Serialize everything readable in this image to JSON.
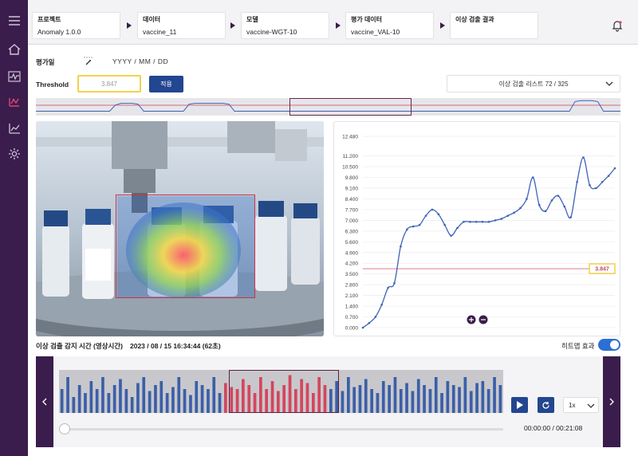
{
  "header": {
    "crumbs": [
      {
        "label": "프로젝트",
        "value": "Anomaly 1.0.0"
      },
      {
        "label": "데이터",
        "value": "vaccine_11"
      },
      {
        "label": "모델",
        "value": "vaccine-WGT-10"
      },
      {
        "label": "평가 데이터",
        "value": "vaccine_VAL-10"
      },
      {
        "label": "이상 검출 결과",
        "value": ""
      }
    ],
    "icons": [
      "menu-icon",
      "bell-icon"
    ]
  },
  "sidebar": {
    "items": [
      {
        "name": "home",
        "icon": "home-icon",
        "active": false
      },
      {
        "name": "monitor",
        "icon": "waveform-icon",
        "active": false
      },
      {
        "name": "anomaly",
        "icon": "anomaly-icon",
        "active": true
      },
      {
        "name": "chart",
        "icon": "chart-icon",
        "active": false
      },
      {
        "name": "settings",
        "icon": "gear-icon",
        "active": false
      }
    ]
  },
  "controls": {
    "date_label": "평가일",
    "date_placeholder": "YYYY / MM / DD",
    "threshold_label": "Threshold",
    "threshold_value": "3.847",
    "apply_label": "적용",
    "anomaly_list": "이상 검출 리스트 72 / 325"
  },
  "detection": {
    "label": "이상 검출 감지 시간 (영상시간)",
    "value": "2023 / 08 / 15 16:34:44 (62초)",
    "heatmap_label": "히트맵 효과",
    "heatmap_on": true
  },
  "player": {
    "speed": "1x",
    "time": "00:00:00 / 00:21:08"
  },
  "colors": {
    "sidebar": "#3a1d4c",
    "primary_button": "#22468f",
    "threshold_line": "#d46a7e",
    "series_line": "#3e63b5",
    "anomaly_bar": "#d4465e",
    "normal_bar": "#3b5fa8",
    "threshold_border": "#f2d24a"
  },
  "chart_data": {
    "type": "line",
    "y_ticks": [
      0,
      0.7,
      1.4,
      2.1,
      2.8,
      3.5,
      4.2,
      4.9,
      5.6,
      6.3,
      7.0,
      7.7,
      8.4,
      9.1,
      9.8,
      10.5,
      11.2,
      12.48
    ],
    "ylim": [
      0,
      12.48
    ],
    "threshold": 3.847,
    "threshold_label": "3.847",
    "series": [
      {
        "values": [
          0.0,
          0.3,
          0.7,
          1.5,
          2.6,
          2.9,
          5.3,
          6.4,
          6.6,
          6.7,
          7.3,
          7.7,
          7.4,
          6.7,
          6.0,
          6.5,
          6.9,
          6.9,
          6.9,
          6.9,
          6.9,
          7.0,
          7.1,
          7.3,
          7.5,
          7.8,
          8.4,
          9.8,
          8.0,
          7.6,
          8.3,
          8.6,
          7.9,
          7.2,
          9.5,
          11.1,
          9.3,
          9.1,
          9.5,
          9.9,
          10.4
        ]
      }
    ],
    "zoom_controls": [
      "zoom-in",
      "zoom-out"
    ]
  },
  "timeline": {
    "bar_heights": [
      0.6,
      0.9,
      0.4,
      0.7,
      0.5,
      0.8,
      0.6,
      0.9,
      0.5,
      0.7,
      0.85,
      0.6,
      0.4,
      0.75,
      0.9,
      0.55,
      0.7,
      0.8,
      0.5,
      0.65,
      0.9,
      0.6,
      0.45,
      0.8,
      0.7,
      0.6,
      0.9,
      0.5,
      0.75,
      0.65,
      0.6,
      0.85,
      0.7,
      0.5,
      0.9,
      0.6,
      0.8,
      0.55,
      0.7,
      0.95,
      0.6,
      0.85,
      0.75,
      0.5,
      0.9,
      0.7,
      0.6,
      0.8,
      0.55,
      0.9,
      0.65,
      0.7,
      0.85,
      0.6,
      0.5,
      0.8,
      0.7,
      0.9,
      0.6,
      0.75,
      0.55,
      0.85,
      0.7,
      0.6,
      0.9,
      0.5,
      0.8,
      0.7,
      0.65,
      0.9,
      0.55,
      0.75,
      0.8,
      0.6,
      0.9,
      0.7
    ],
    "anomaly_range": [
      28,
      46
    ]
  },
  "overview": {
    "signal": [
      0.75,
      0.75,
      0.75,
      0.75,
      0.75,
      0.75,
      0.75,
      0.75,
      0.75,
      0.75,
      0.75,
      0.75,
      0.75,
      0.75,
      0.4,
      0.3,
      0.3,
      0.3,
      0.35,
      0.75,
      0.75,
      0.75,
      0.75,
      0.75,
      0.75,
      0.75,
      0.75,
      0.35,
      0.3,
      0.3,
      0.3,
      0.3,
      0.3,
      0.3,
      0.35,
      0.75,
      0.75,
      0.75,
      0.75,
      0.75,
      0.75,
      0.75,
      0.75,
      0.75,
      0.75,
      0.75,
      0.75,
      0.75,
      0.75,
      0.75,
      0.75,
      0.75,
      0.75,
      0.75,
      0.75,
      0.75,
      0.75,
      0.75,
      0.75,
      0.75,
      0.75,
      0.75,
      0.75,
      0.75,
      0.75,
      0.75,
      0.75,
      0.75,
      0.75,
      0.75,
      0.75,
      0.75,
      0.75,
      0.75,
      0.75,
      0.75,
      0.75,
      0.75,
      0.75,
      0.75,
      0.75,
      0.75,
      0.75,
      0.75,
      0.75,
      0.75,
      0.75,
      0.75,
      0.75,
      0.75,
      0.75,
      0.75,
      0.75,
      0.75,
      0.75,
      0.2,
      0.15,
      0.15,
      0.15,
      0.2,
      0.75,
      0.75,
      0.75,
      0.75
    ]
  }
}
